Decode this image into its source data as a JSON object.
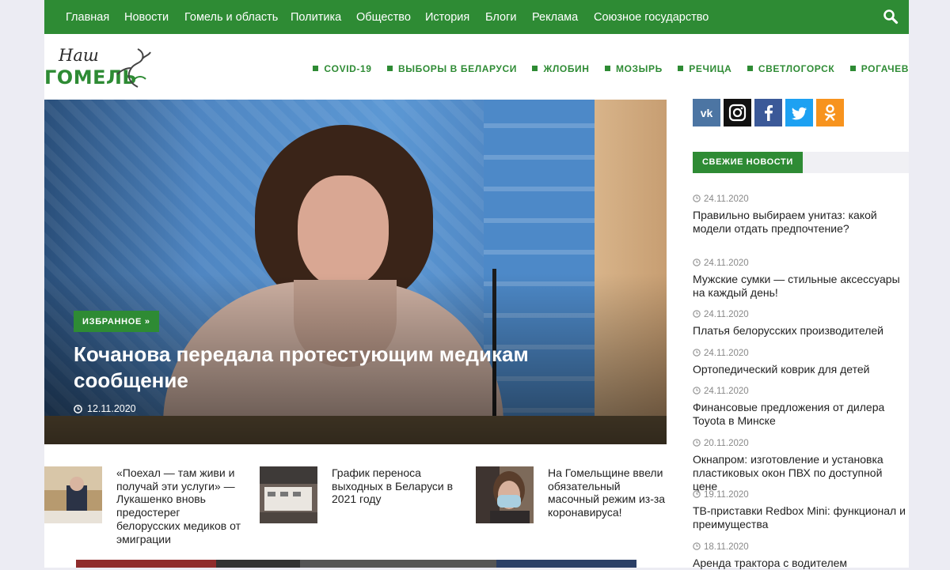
{
  "nav": {
    "items": [
      "Главная",
      "Новости",
      "Гомель и область",
      "Политика",
      "Общество",
      "История",
      "Блоги",
      "Реклама",
      "Союзное государство"
    ],
    "search_icon": "search-icon"
  },
  "logo": {
    "script": "Наш",
    "word": "ГОМЕЛЬ"
  },
  "categories": [
    "COVID-19",
    "ВЫБОРЫ В БЕЛАРУСИ",
    "ЖЛОБИН",
    "МОЗЫРЬ",
    "РЕЧИЦА",
    "СВЕТЛОГОРСК",
    "РОГАЧЕВ"
  ],
  "hero": {
    "badge": "ИЗБРАННОЕ »",
    "title": "Кочанова передала протестующим медикам сообщение",
    "date": "12.11.2020"
  },
  "articles": [
    {
      "title": "«Поехал — там живи и получай эти услуги» — Лукашенко вновь предостерег белорусских медиков от эмиграции"
    },
    {
      "title": "График переноса выходных в Беларуси в 2021 году"
    },
    {
      "title": "На Гомельщине ввели обязательный масочный режим из-за коронавируса!"
    }
  ],
  "social": [
    {
      "name": "vk",
      "color": "#4c75a3"
    },
    {
      "name": "instagram",
      "color": "#111111"
    },
    {
      "name": "facebook",
      "color": "#3b5998"
    },
    {
      "name": "twitter",
      "color": "#1da1f2"
    },
    {
      "name": "odnoklassniki",
      "color": "#f7931e"
    }
  ],
  "sidebar": {
    "section_label": "СВЕЖИЕ НОВОСТИ",
    "news": [
      {
        "date": "24.11.2020",
        "title": "Правильно выбираем унитаз: какой модели отдать предпочтение?"
      },
      {
        "date": "24.11.2020",
        "title": "Мужские сумки — стильные аксессуары на каждый день!"
      },
      {
        "date": "24.11.2020",
        "title": "Платья белорусских производителей"
      },
      {
        "date": "24.11.2020",
        "title": "Ортопедический коврик для детей"
      },
      {
        "date": "24.11.2020",
        "title": "Финансовые предложения от дилера Toyota в Минске"
      },
      {
        "date": "20.11.2020",
        "title": "Окнапром: изготовление и установка пластиковых окон ПВХ по доступной цене"
      },
      {
        "date": "19.11.2020",
        "title": "ТВ-приставки Redbox Mini: функционал и преимущества"
      },
      {
        "date": "18.11.2020",
        "title": "Аренда трактора с водителем"
      }
    ]
  },
  "colors": {
    "brand": "#2e8b34",
    "background": "#ececf3"
  }
}
